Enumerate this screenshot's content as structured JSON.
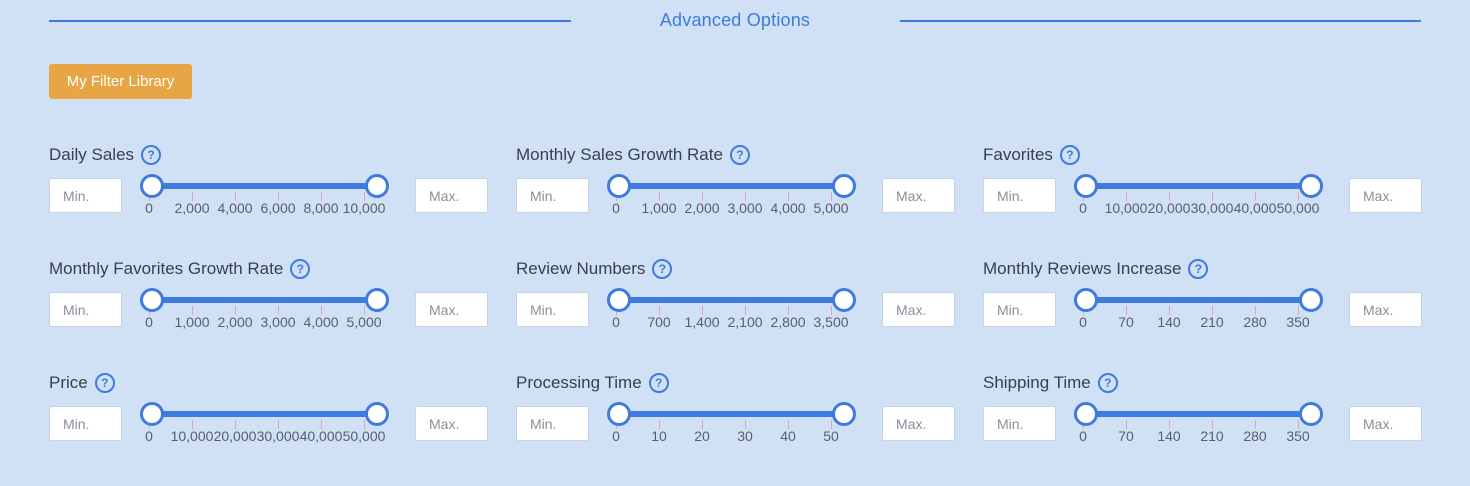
{
  "section": {
    "title": "Advanced Options"
  },
  "library_button": {
    "label": "My Filter Library"
  },
  "filters": [
    {
      "id": "daily-sales",
      "label": "Daily Sales",
      "min_placeholder": "Min.",
      "max_placeholder": "Max.",
      "ticks": [
        "0",
        "2,000",
        "4,000",
        "6,000",
        "8,000",
        "10,000"
      ]
    },
    {
      "id": "monthly-sales-growth-rate",
      "label": "Monthly Sales Growth Rate",
      "min_placeholder": "Min.",
      "max_placeholder": "Max.",
      "ticks": [
        "0",
        "1,000",
        "2,000",
        "3,000",
        "4,000",
        "5,000"
      ]
    },
    {
      "id": "favorites",
      "label": "Favorites",
      "min_placeholder": "Min.",
      "max_placeholder": "Max.",
      "ticks": [
        "0",
        "10,000",
        "20,000",
        "30,000",
        "40,000",
        "50,000"
      ]
    },
    {
      "id": "monthly-favorites-growth-rate",
      "label": "Monthly Favorites Growth Rate",
      "min_placeholder": "Min.",
      "max_placeholder": "Max.",
      "ticks": [
        "0",
        "1,000",
        "2,000",
        "3,000",
        "4,000",
        "5,000"
      ]
    },
    {
      "id": "review-numbers",
      "label": "Review Numbers",
      "min_placeholder": "Min.",
      "max_placeholder": "Max.",
      "ticks": [
        "0",
        "700",
        "1,400",
        "2,100",
        "2,800",
        "3,500"
      ]
    },
    {
      "id": "monthly-reviews-increase",
      "label": "Monthly Reviews Increase",
      "min_placeholder": "Min.",
      "max_placeholder": "Max.",
      "ticks": [
        "0",
        "70",
        "140",
        "210",
        "280",
        "350"
      ]
    },
    {
      "id": "price",
      "label": "Price",
      "min_placeholder": "Min.",
      "max_placeholder": "Max.",
      "ticks": [
        "0",
        "10,000",
        "20,000",
        "30,000",
        "40,000",
        "50,000"
      ]
    },
    {
      "id": "processing-time",
      "label": "Processing Time",
      "min_placeholder": "Min.",
      "max_placeholder": "Max.",
      "ticks": [
        "0",
        "10",
        "20",
        "30",
        "40",
        "50"
      ]
    },
    {
      "id": "shipping-time",
      "label": "Shipping Time",
      "min_placeholder": "Min.",
      "max_placeholder": "Max.",
      "ticks": [
        "0",
        "70",
        "140",
        "210",
        "280",
        "350"
      ]
    }
  ],
  "colors": {
    "accent": "#3f7ade",
    "button": "#e8a545",
    "background": "#d0e0f5"
  }
}
